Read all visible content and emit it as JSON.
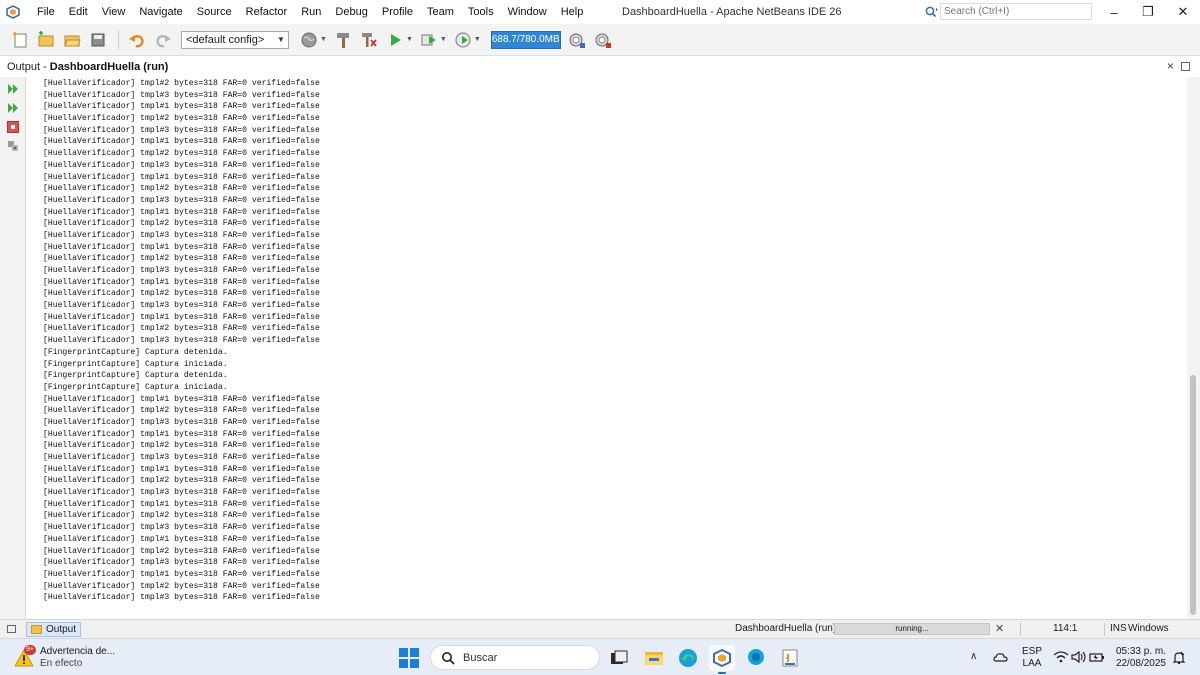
{
  "window": {
    "title": "DashboardHuella - Apache NetBeans IDE 26",
    "search_placeholder": "Search (Ctrl+I)",
    "minimize": "–",
    "maximize": "❐",
    "close": "✕"
  },
  "menu": [
    "File",
    "Edit",
    "View",
    "Navigate",
    "Source",
    "Refactor",
    "Run",
    "Debug",
    "Profile",
    "Team",
    "Tools",
    "Window",
    "Help"
  ],
  "toolbar": {
    "config_selected": "<default config>",
    "memory": "688.7/780.0MB"
  },
  "output": {
    "label": "Output - ",
    "project": "DashboardHuella (run)",
    "close": "×",
    "lines": [
      "[HuellaVerificador] tmpl#2 bytes=318 FAR=0 verified=false",
      "[HuellaVerificador] tmpl#3 bytes=318 FAR=0 verified=false",
      "[HuellaVerificador] tmpl#1 bytes=318 FAR=0 verified=false",
      "[HuellaVerificador] tmpl#2 bytes=318 FAR=0 verified=false",
      "[HuellaVerificador] tmpl#3 bytes=318 FAR=0 verified=false",
      "[HuellaVerificador] tmpl#1 bytes=318 FAR=0 verified=false",
      "[HuellaVerificador] tmpl#2 bytes=318 FAR=0 verified=false",
      "[HuellaVerificador] tmpl#3 bytes=318 FAR=0 verified=false",
      "[HuellaVerificador] tmpl#1 bytes=318 FAR=0 verified=false",
      "[HuellaVerificador] tmpl#2 bytes=318 FAR=0 verified=false",
      "[HuellaVerificador] tmpl#3 bytes=318 FAR=0 verified=false",
      "[HuellaVerificador] tmpl#1 bytes=318 FAR=0 verified=false",
      "[HuellaVerificador] tmpl#2 bytes=318 FAR=0 verified=false",
      "[HuellaVerificador] tmpl#3 bytes=318 FAR=0 verified=false",
      "[HuellaVerificador] tmpl#1 bytes=318 FAR=0 verified=false",
      "[HuellaVerificador] tmpl#2 bytes=318 FAR=0 verified=false",
      "[HuellaVerificador] tmpl#3 bytes=318 FAR=0 verified=false",
      "[HuellaVerificador] tmpl#1 bytes=318 FAR=0 verified=false",
      "[HuellaVerificador] tmpl#2 bytes=318 FAR=0 verified=false",
      "[HuellaVerificador] tmpl#3 bytes=318 FAR=0 verified=false",
      "[HuellaVerificador] tmpl#1 bytes=318 FAR=0 verified=false",
      "[HuellaVerificador] tmpl#2 bytes=318 FAR=0 verified=false",
      "[HuellaVerificador] tmpl#3 bytes=318 FAR=0 verified=false",
      "[FingerprintCapture] Captura detenida.",
      "[FingerprintCapture] Captura iniciada.",
      "[FingerprintCapture] Captura detenida.",
      "[FingerprintCapture] Captura iniciada.",
      "[HuellaVerificador] tmpl#1 bytes=318 FAR=0 verified=false",
      "[HuellaVerificador] tmpl#2 bytes=318 FAR=0 verified=false",
      "[HuellaVerificador] tmpl#3 bytes=318 FAR=0 verified=false",
      "[HuellaVerificador] tmpl#1 bytes=318 FAR=0 verified=false",
      "[HuellaVerificador] tmpl#2 bytes=318 FAR=0 verified=false",
      "[HuellaVerificador] tmpl#3 bytes=318 FAR=0 verified=false",
      "[HuellaVerificador] tmpl#1 bytes=318 FAR=0 verified=false",
      "[HuellaVerificador] tmpl#2 bytes=318 FAR=0 verified=false",
      "[HuellaVerificador] tmpl#3 bytes=318 FAR=0 verified=false",
      "[HuellaVerificador] tmpl#1 bytes=318 FAR=0 verified=false",
      "[HuellaVerificador] tmpl#2 bytes=318 FAR=0 verified=false",
      "[HuellaVerificador] tmpl#3 bytes=318 FAR=0 verified=false",
      "[HuellaVerificador] tmpl#1 bytes=318 FAR=0 verified=false",
      "[HuellaVerificador] tmpl#2 bytes=318 FAR=0 verified=false",
      "[HuellaVerificador] tmpl#3 bytes=318 FAR=0 verified=false",
      "[HuellaVerificador] tmpl#1 bytes=318 FAR=0 verified=false",
      "[HuellaVerificador] tmpl#2 bytes=318 FAR=0 verified=false",
      "[HuellaVerificador] tmpl#3 bytes=318 FAR=0 verified=false"
    ]
  },
  "statusbar": {
    "tab_label": "Output",
    "project": "DashboardHuella (run)",
    "progress_text": "running...",
    "progress_cancel": "✕",
    "caret_position": "114:1",
    "insert_mode": "INS",
    "line_endings": "Windows (CRLF)"
  },
  "taskbar": {
    "notification_title": "Advertencia de...",
    "notification_subtitle": "En efecto",
    "notification_badge": "9+",
    "search_label": "Buscar",
    "language_line1": "ESP",
    "language_line2": "LAA",
    "time": "05:33 p. m.",
    "date": "22/08/2025",
    "tray_chevron": "∧"
  },
  "icons": {
    "app": "netbeans-logo-icon",
    "search": "magnifier-icon",
    "accent": "#2f86d6"
  }
}
